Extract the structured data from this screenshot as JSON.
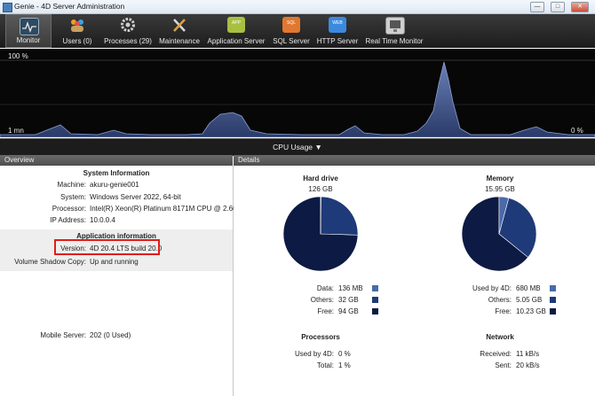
{
  "window": {
    "title": "Genie - 4D Server Administration"
  },
  "toolbar": {
    "items": [
      {
        "label": "Monitor",
        "icon": "monitor-icon",
        "active": true
      },
      {
        "label": "Users (0)",
        "icon": "users-icon"
      },
      {
        "label": "Processes (29)",
        "icon": "gear-icon"
      },
      {
        "label": "Maintenance",
        "icon": "tools-icon"
      },
      {
        "label": "Application Server",
        "icon": "app-icon"
      },
      {
        "label": "SQL Server",
        "icon": "sql-icon"
      },
      {
        "label": "HTTP Server",
        "icon": "web-icon"
      },
      {
        "label": "Real Time Monitor",
        "icon": "rtm-icon"
      }
    ]
  },
  "graph": {
    "max_label": "100 %",
    "time_label": "1 mn",
    "current_label": "0 %"
  },
  "cpu_selector": {
    "label": "CPU Usage"
  },
  "sections": {
    "overview": "Overview",
    "details": "Details"
  },
  "overview": {
    "system_header": "System Information",
    "system": [
      {
        "label": "Machine:",
        "value": "akuru-genie001"
      },
      {
        "label": "System:",
        "value": "Windows Server 2022, 64-bit"
      },
      {
        "label": "Processor:",
        "value": "Intel(R) Xeon(R) Platinum 8171M CPU @ 2.60GHz"
      },
      {
        "label": "IP Address:",
        "value": "10.0.0.4"
      }
    ],
    "app_header": "Application information",
    "app": [
      {
        "label": "Version:",
        "value": "4D 20.4 LTS build 20.0"
      },
      {
        "label": "Volume Shadow Copy:",
        "value": "Up and running"
      }
    ],
    "mobile": {
      "label": "Mobile Server:",
      "value": "202 (0 Used)"
    }
  },
  "details": {
    "hard_drive": {
      "title": "Hard drive",
      "total": "126 GB",
      "legend": [
        {
          "label": "Data:",
          "value": "136 MB",
          "color": "#4a6aa8"
        },
        {
          "label": "Others:",
          "value": "32 GB",
          "color": "#1f3a78"
        },
        {
          "label": "Free:",
          "value": "94 GB",
          "color": "#0c1a44"
        }
      ]
    },
    "memory": {
      "title": "Memory",
      "total": "15.95 GB",
      "legend": [
        {
          "label": "Used by 4D:",
          "value": "680 MB",
          "color": "#4a6aa8"
        },
        {
          "label": "Others:",
          "value": "5.05 GB",
          "color": "#1f3a78"
        },
        {
          "label": "Free:",
          "value": "10.23 GB",
          "color": "#0c1a44"
        }
      ]
    },
    "processors": {
      "title": "Processors",
      "rows": [
        {
          "label": "Used by 4D:",
          "value": "0 %"
        },
        {
          "label": "Total:",
          "value": "1 %"
        }
      ]
    },
    "network": {
      "title": "Network",
      "rows": [
        {
          "label": "Received:",
          "value": "11 kB/s"
        },
        {
          "label": "Sent:",
          "value": "20 kB/s"
        }
      ]
    }
  }
}
